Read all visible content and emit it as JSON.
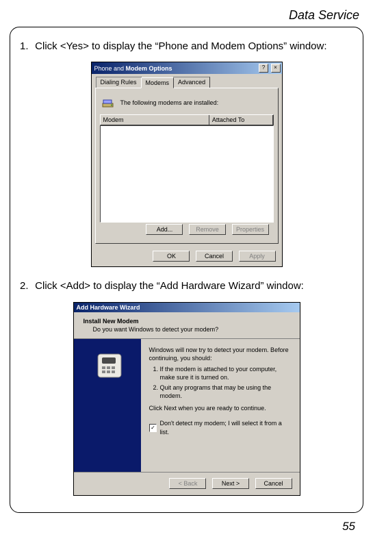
{
  "header": "Data Service",
  "page_number": "55",
  "steps": {
    "s1_num": "1.",
    "s1_text": "Click <Yes> to display the “Phone and Modem Options” window:",
    "s2_num": "2.",
    "s2_text": "Click <Add> to display the “Add Hardware Wizard” window:"
  },
  "dlg1": {
    "title_plain": "Phone and ",
    "title_bold": "Modem Options",
    "help_glyph": "?",
    "close_glyph": "×",
    "tabs": {
      "t1": "Dialing Rules",
      "t2": "Modems",
      "t3": "Advanced"
    },
    "info_line": "The following modems are installed:",
    "col1": "Modem",
    "col2": "Attached To",
    "btn_add": "Add...",
    "btn_remove": "Remove",
    "btn_props": "Properties",
    "btn_ok": "OK",
    "btn_cancel": "Cancel",
    "btn_apply": "Apply"
  },
  "dlg2": {
    "title": "Add Hardware Wizard",
    "head_title": "Install New Modem",
    "head_sub": "Do you want Windows to detect your modem?",
    "intro": "Windows will now try to detect your modem. Before continuing, you should:",
    "li1": "If the modem is attached to your computer, make sure it is turned on.",
    "li2": "Quit any programs that may be using the modem.",
    "cont": "Click Next when you are ready to continue.",
    "chk_mark": "✓",
    "chk_label": "Don't detect my modem; I will select it from a list.",
    "btn_back": "< Back",
    "btn_next": "Next >",
    "btn_cancel": "Cancel"
  }
}
